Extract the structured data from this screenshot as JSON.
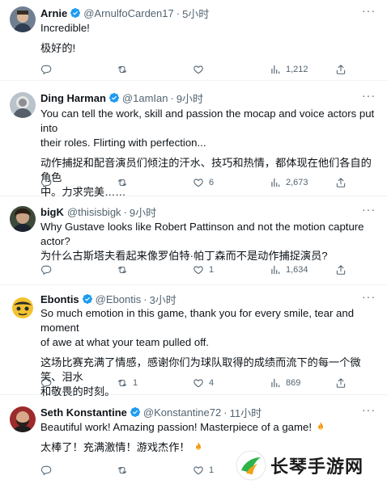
{
  "colors": {
    "verified": "#1d9bf0",
    "text": "#0f1419",
    "muted": "#536471",
    "divider": "#eff3f4"
  },
  "icons": [
    "verified-badge-icon",
    "reply-icon",
    "retweet-icon",
    "like-icon",
    "views-icon",
    "share-icon",
    "more-icon",
    "fire-icon"
  ],
  "tweets": [
    {
      "name": "Arnie",
      "handle": "@ArnulfoCarden17",
      "dot": "·",
      "time": "5小时",
      "more": "···",
      "lines": [
        "Incredible!",
        "极好的!"
      ],
      "replies": "",
      "retweets": "",
      "likes": "",
      "views": "1,212"
    },
    {
      "name": "Ding Harman",
      "handle": "@1amIan",
      "dot": "·",
      "time": "9小时",
      "more": "···",
      "lines": [
        "You can tell the work, skill and passion the mocap and voice actors put into",
        "their roles. Flirting with perfection...",
        "动作捕捉和配音演员们倾注的汗水、技巧和热情，都体现在他们各自的角色",
        "中。力求完美……"
      ],
      "replies": "",
      "retweets": "",
      "likes": "6",
      "views": "2,673"
    },
    {
      "name": "bigK",
      "handle": "@thisisbigk",
      "dot": "·",
      "time": "9小时",
      "more": "···",
      "lines": [
        "Why Gustave looks like Robert Pattinson and not the motion capture actor?",
        "为什么古斯塔夫看起来像罗伯特·帕丁森而不是动作捕捉演员?"
      ],
      "replies": "",
      "retweets": "",
      "likes": "1",
      "views": "1,634"
    },
    {
      "name": "Ebontis",
      "handle": "@Ebontis",
      "dot": "·",
      "time": "3小时",
      "more": "···",
      "lines": [
        "So much emotion in this game, thank you for every smile, tear and moment",
        "of awe at what your team pulled off.",
        "这场比赛充满了情感，感谢你们为球队取得的成绩而流下的每一个微笑、泪水",
        "和敬畏的时刻。"
      ],
      "replies": "",
      "retweets": "1",
      "likes": "4",
      "views": "869"
    },
    {
      "name": "Seth Konstantine",
      "handle": "@Konstantine72",
      "dot": "·",
      "time": "11小时",
      "more": "···",
      "lines": [
        "Beautiful work! Amazing passion! Masterpiece of a game!",
        "太棒了！充满激情！游戏杰作！"
      ],
      "replies": "",
      "retweets": "",
      "likes": "1",
      "views": ""
    }
  ],
  "watermark": {
    "text": "长琴手游网"
  }
}
